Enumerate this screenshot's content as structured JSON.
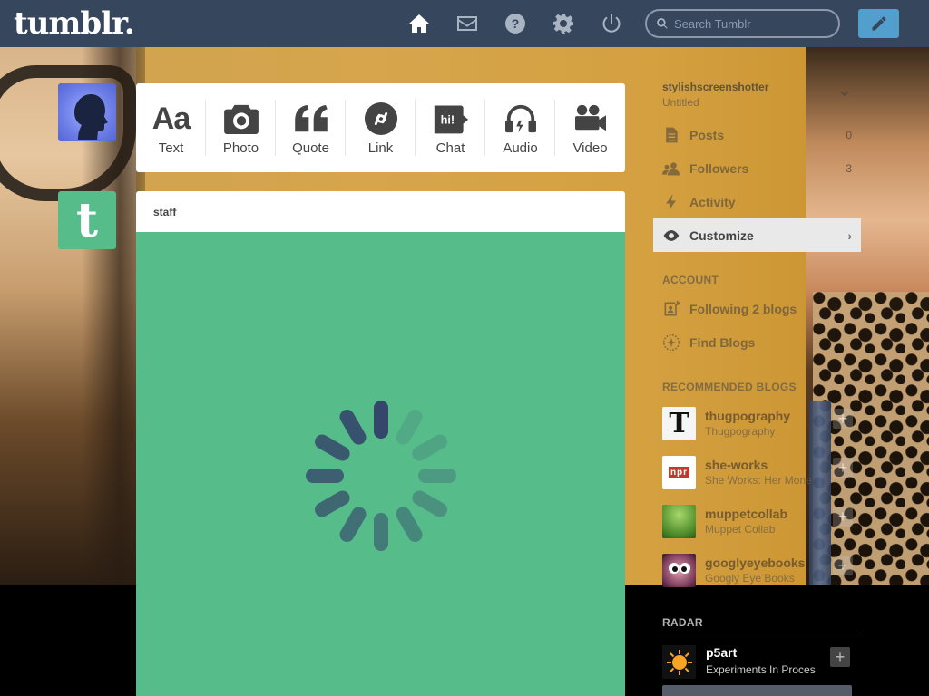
{
  "header": {
    "logo": "tumblr.",
    "nav": [
      {
        "name": "home-icon"
      },
      {
        "name": "mail-icon"
      },
      {
        "name": "help-icon"
      },
      {
        "name": "gear-icon"
      },
      {
        "name": "power-icon"
      }
    ],
    "search_placeholder": "Search Tumblr",
    "compose_icon": "pencil-icon"
  },
  "post_types": [
    {
      "label": "Text",
      "icon": "aa-text-icon",
      "glyph": "Aa"
    },
    {
      "label": "Photo",
      "icon": "camera-icon"
    },
    {
      "label": "Quote",
      "icon": "quote-icon"
    },
    {
      "label": "Link",
      "icon": "link-icon"
    },
    {
      "label": "Chat",
      "icon": "chat-bubble-icon",
      "glyph": "hi!"
    },
    {
      "label": "Audio",
      "icon": "headphones-icon"
    },
    {
      "label": "Video",
      "icon": "video-camera-icon"
    }
  ],
  "post": {
    "author": "staff",
    "background_color": "#56bc8a",
    "loading": true
  },
  "staff_avatar_letter": "t",
  "sidebar": {
    "blog_name": "stylishscreenshotter",
    "blog_subtitle": "Untitled",
    "items": [
      {
        "label": "Posts",
        "count": "0"
      },
      {
        "label": "Followers",
        "count": "3"
      },
      {
        "label": "Activity",
        "count": ""
      },
      {
        "label": "Customize",
        "count": ""
      }
    ],
    "account_label": "ACCOUNT",
    "account_items": [
      {
        "label": "Following 2 blogs"
      },
      {
        "label": "Find Blogs"
      }
    ],
    "recommended_label": "RECOMMENDED BLOGS",
    "recommended": [
      {
        "name": "thugpography",
        "desc": "Thugpography",
        "thumb_letter": "T"
      },
      {
        "name": "she-works",
        "desc": "She Works: Her Mone",
        "thumb_letter": "npr"
      },
      {
        "name": "muppetcollab",
        "desc": "Muppet Collab",
        "thumb_letter": ""
      },
      {
        "name": "googlyeyebooks",
        "desc": "Googly Eye Books",
        "thumb_letter": ""
      }
    ],
    "radar_label": "RADAR",
    "radar": {
      "name": "p5art",
      "desc": "Experiments In Proces"
    }
  },
  "colors": {
    "header_bg": "#36465d",
    "accent_blue": "#529ecc",
    "staff_green": "#56bc8a"
  }
}
